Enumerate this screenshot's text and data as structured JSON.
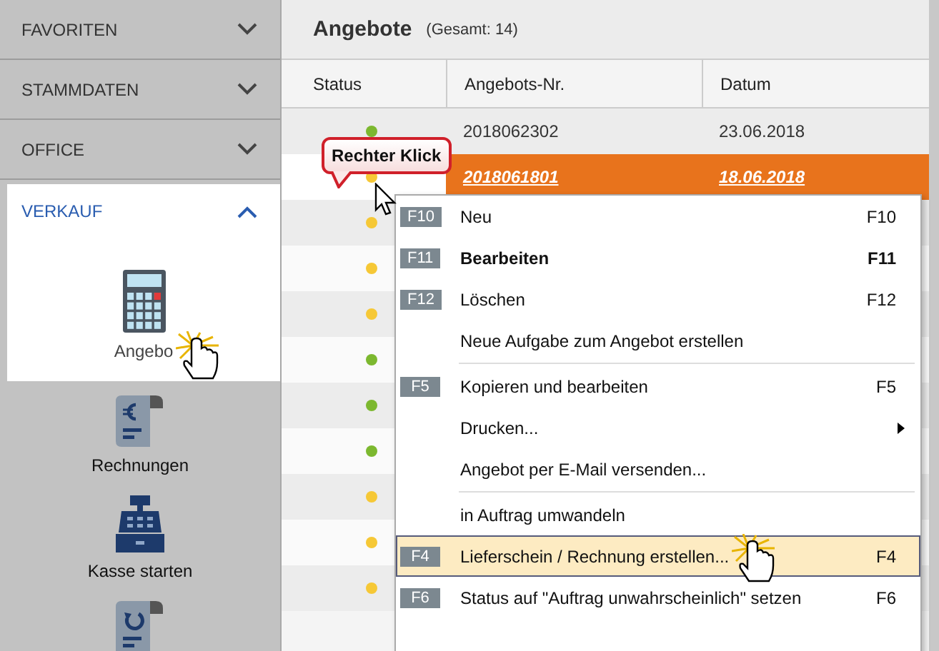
{
  "sidebar": {
    "sections": [
      {
        "title": "FAVORITEN",
        "expanded": false
      },
      {
        "title": "STAMMDATEN",
        "expanded": false
      },
      {
        "title": "OFFICE",
        "expanded": false
      },
      {
        "title": "VERKAUF",
        "expanded": true,
        "items": [
          {
            "kind": "calculator",
            "label": "Angebo",
            "selected": true
          },
          {
            "kind": "invoice",
            "label": "Rechnungen",
            "selected": false
          },
          {
            "kind": "register",
            "label": "Kasse starten",
            "selected": false
          },
          {
            "kind": "refund",
            "selected": false
          }
        ]
      }
    ]
  },
  "panel": {
    "title": "Angebote",
    "count": "(Gesamt: 14)"
  },
  "table": {
    "columns": [
      "Status",
      "Angebots-Nr.",
      "Datum"
    ],
    "rows": [
      {
        "color": "#7cb82f",
        "number": "2018062302",
        "date": "23.06.2018",
        "selected": false
      },
      {
        "color": "#f6c836",
        "number": "2018061801",
        "date": "18.06.2018",
        "selected": true
      },
      {
        "color": "#f6c836",
        "selected": false
      },
      {
        "color": "#f6c836",
        "selected": false
      },
      {
        "color": "#f6c836",
        "selected": false
      },
      {
        "color": "#7cb82f",
        "selected": false
      },
      {
        "color": "#7cb82f",
        "selected": false
      },
      {
        "color": "#7cb82f",
        "selected": false
      },
      {
        "color": "#f6c836",
        "selected": false
      },
      {
        "color": "#f6c836",
        "selected": false
      },
      {
        "color": "#f6c836",
        "selected": false
      }
    ]
  },
  "callout": {
    "text": "Rechter Klick"
  },
  "context_menu": {
    "items": [
      {
        "kind": "item",
        "badge": "F10",
        "label": "Neu",
        "shortcut": "F10",
        "default": false,
        "submenu": false,
        "selected": false
      },
      {
        "kind": "item",
        "badge": "F11",
        "label": "Bearbeiten",
        "shortcut": "F11",
        "default": true,
        "submenu": false,
        "selected": false
      },
      {
        "kind": "item",
        "badge": "F12",
        "label": "Löschen",
        "shortcut": "F12",
        "default": false,
        "submenu": false,
        "selected": false
      },
      {
        "kind": "item",
        "label": "Neue Aufgabe zum Angebot erstellen",
        "default": false,
        "submenu": false,
        "selected": false
      },
      {
        "kind": "separator"
      },
      {
        "kind": "item",
        "badge": "F5",
        "label": "Kopieren und bearbeiten",
        "shortcut": "F5",
        "default": false,
        "submenu": false,
        "selected": false
      },
      {
        "kind": "item",
        "label": "Drucken...",
        "default": false,
        "submenu": true,
        "selected": false
      },
      {
        "kind": "item",
        "label": "Angebot per E-Mail versenden...",
        "default": false,
        "submenu": false,
        "selected": false
      },
      {
        "kind": "separator"
      },
      {
        "kind": "item",
        "label": "in Auftrag umwandeln",
        "default": false,
        "submenu": false,
        "selected": false
      },
      {
        "kind": "item",
        "badge": "F4",
        "label": "Lieferschein / Rechnung erstellen...",
        "shortcut": "F4",
        "default": false,
        "submenu": false,
        "selected": true
      },
      {
        "kind": "item",
        "badge": "F6",
        "label": "Status auf \"Auftrag unwahrscheinlich\" setzen",
        "shortcut": "F6",
        "default": false,
        "submenu": false,
        "selected": false
      }
    ]
  }
}
